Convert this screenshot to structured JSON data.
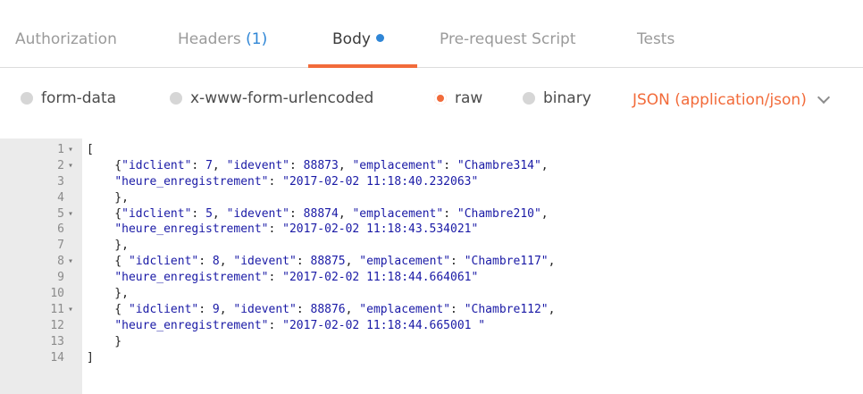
{
  "tabs": {
    "authorization": "Authorization",
    "headers": "Headers",
    "headers_count": "(1)",
    "body": "Body",
    "prerequest": "Pre-request Script",
    "tests": "Tests"
  },
  "body_options": {
    "form_data": "form-data",
    "urlencoded": "x-www-form-urlencoded",
    "raw": "raw",
    "binary": "binary",
    "selected": "raw",
    "content_type": "JSON (application/json)"
  },
  "colors": {
    "accent": "#f26b3a",
    "blue": "#2f86d6",
    "string": "#1a1aa6"
  },
  "editor": {
    "lines": [
      {
        "n": "1",
        "fold": true,
        "code": "["
      },
      {
        "n": "2",
        "fold": true,
        "code": "    {\"idclient\": 7, \"idevent\": 88873, \"emplacement\": \"Chambre314\","
      },
      {
        "n": "3",
        "fold": false,
        "code": "    \"heure_enregistrement\": \"2017-02-02 11:18:40.232063\""
      },
      {
        "n": "4",
        "fold": false,
        "code": "    },"
      },
      {
        "n": "5",
        "fold": true,
        "code": "    {\"idclient\": 5, \"idevent\": 88874, \"emplacement\": \"Chambre210\","
      },
      {
        "n": "6",
        "fold": false,
        "code": "    \"heure_enregistrement\": \"2017-02-02 11:18:43.534021\""
      },
      {
        "n": "7",
        "fold": false,
        "code": "    },"
      },
      {
        "n": "8",
        "fold": true,
        "code": "    { \"idclient\": 8, \"idevent\": 88875, \"emplacement\": \"Chambre117\","
      },
      {
        "n": "9",
        "fold": false,
        "code": "    \"heure_enregistrement\": \"2017-02-02 11:18:44.664061\""
      },
      {
        "n": "10",
        "fold": false,
        "code": "    },"
      },
      {
        "n": "11",
        "fold": true,
        "code": "    { \"idclient\": 9, \"idevent\": 88876, \"emplacement\": \"Chambre112\","
      },
      {
        "n": "12",
        "fold": false,
        "code": "    \"heure_enregistrement\": \"2017-02-02 11:18:44.665001 \""
      },
      {
        "n": "13",
        "fold": false,
        "code": "    }"
      },
      {
        "n": "14",
        "fold": false,
        "code": "]"
      }
    ]
  }
}
